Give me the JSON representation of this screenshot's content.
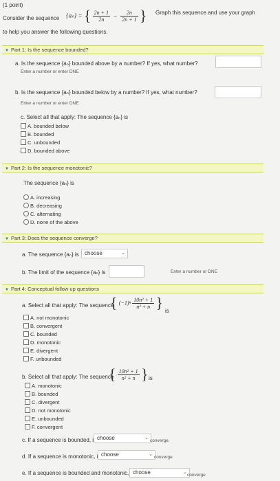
{
  "header": {
    "points": "(1 point)",
    "intro_prefix": "Consider the sequence",
    "seq_symbol": "{aₙ} =",
    "frac1_num": "2n + 1",
    "frac1_den": "2n",
    "frac2_num": "2n",
    "frac2_den": "2n + 1",
    "graph_text": "Graph this sequence and use your graph",
    "intro_suffix": "to help you answer the following questions."
  },
  "part1": {
    "title": "Part 1: Is the sequence bounded?",
    "qa": "a. Is the sequence {aₙ} bounded above by a number? If yes, what number?",
    "qa_hint": "Enter a number or enter DNE",
    "qb": "b. Is the sequence {aₙ} bounded below by a number? If yes, what number?",
    "qb_hint": "Enter a number or enter DNE",
    "qc": "c. Select all that apply: The sequence {aₙ} is",
    "options": [
      "A. bounded below",
      "B. bounded",
      "C. unbounded",
      "D. bounded above"
    ]
  },
  "part2": {
    "title": "Part 2: Is the sequence monotonic?",
    "q": "The sequence {aₙ} is",
    "options": [
      "A. increasing",
      "B. decreasing",
      "C. alternating",
      "D. none of the above"
    ]
  },
  "part3": {
    "title": "Part 3: Does the sequence converge?",
    "qa": "a. The sequence {aₙ} is",
    "qa_select": "choose",
    "qb": "b. The limit of the sequence {aₙ} is",
    "qb_hint": "Enter a number or DNE"
  },
  "part4": {
    "title": "Part 4: Conceptual follow up questions",
    "qa_prefix": "a. Select all that apply: The sequence",
    "qa_factor": "(−1)ⁿ",
    "qa_num": "10n² + 1",
    "qa_den": "n² + n",
    "qa_suffix": "is",
    "qa_options": [
      "A. not monotonic",
      "B. convergent",
      "C. bounded",
      "D. monotonic",
      "E. divergent",
      "F. unbounded"
    ],
    "qb_prefix": "b. Select all that apply: The sequence",
    "qb_num": "10n² + 1",
    "qb_den": "n² + n",
    "qb_suffix": "is",
    "qb_options": [
      "A. monotonic",
      "B. bounded",
      "C. divergent",
      "D. not monotonic",
      "E. unbounded",
      "F. convergent"
    ],
    "qc": "c. If a sequence is bounded, it",
    "qc_select": "choose",
    "qc_trail": "converge.",
    "qd": "d. If a sequence is monotonic, it",
    "qd_select": "choose",
    "qd_trail": "converge",
    "qe": "e. If a sequence is bounded and monotonic, it",
    "qe_select": "choose",
    "qe_trail": "converge"
  }
}
